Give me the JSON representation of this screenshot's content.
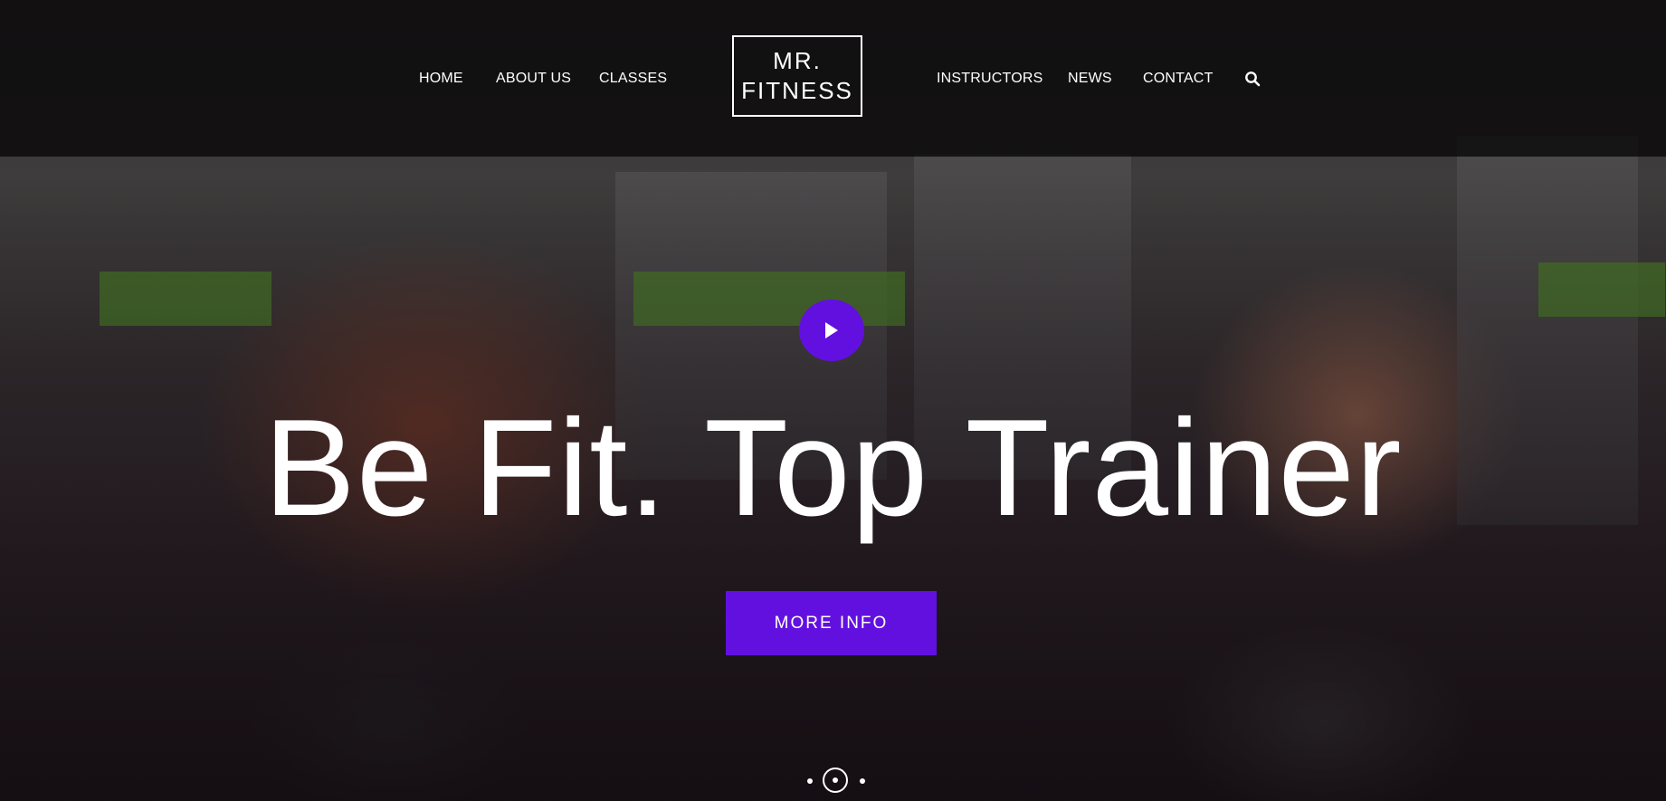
{
  "nav": {
    "left": [
      "HOME",
      "ABOUT US",
      "CLASSES"
    ],
    "right": [
      "INSTRUCTORS",
      "NEWS",
      "CONTACT"
    ]
  },
  "logo": {
    "line1": "MR.",
    "line2": "FITNESS"
  },
  "hero": {
    "title": "Be Fit. Top Trainer",
    "cta_label": "MORE INFO"
  },
  "slider": {
    "total": 3,
    "active": 2
  },
  "colors": {
    "accent": "#6210e0",
    "header_bg": "#080608"
  },
  "icons": [
    "search-icon",
    "play-icon"
  ]
}
